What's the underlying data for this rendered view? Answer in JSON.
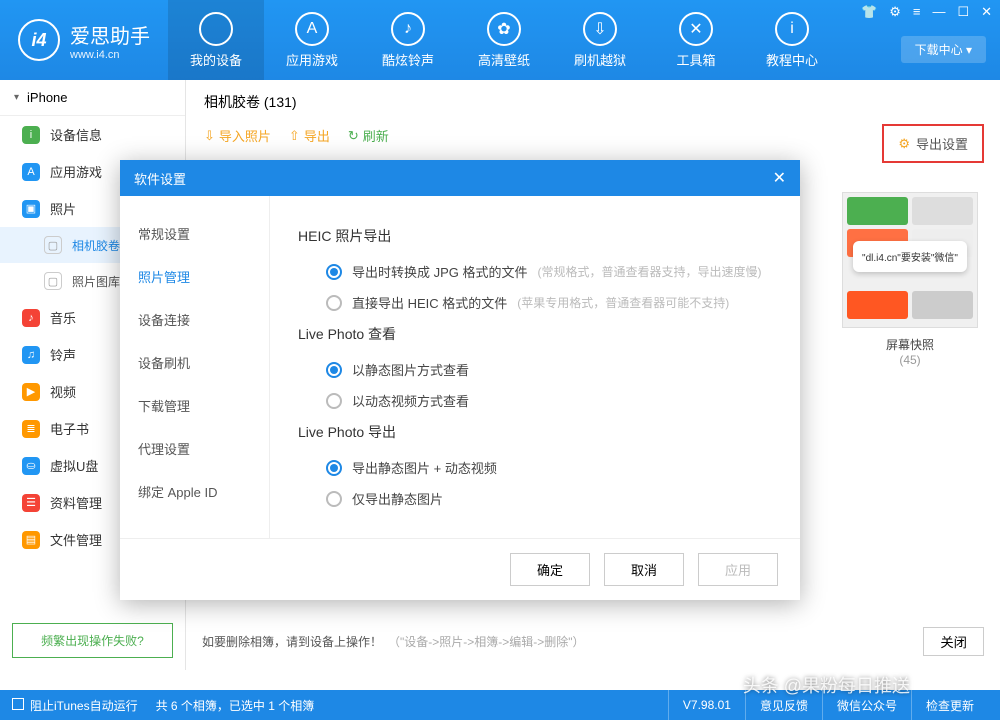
{
  "app": {
    "name": "爱思助手",
    "site": "www.i4.cn",
    "logo": "i4"
  },
  "titlebar": {
    "download": "下载中心 ▾"
  },
  "nav": [
    {
      "label": "我的设备",
      "icon": ""
    },
    {
      "label": "应用游戏",
      "icon": "A"
    },
    {
      "label": "酷炫铃声",
      "icon": "♪"
    },
    {
      "label": "高清壁纸",
      "icon": "✿"
    },
    {
      "label": "刷机越狱",
      "icon": "⇩"
    },
    {
      "label": "工具箱",
      "icon": "✕"
    },
    {
      "label": "教程中心",
      "icon": "i"
    }
  ],
  "device": "iPhone",
  "sidebar": [
    {
      "label": "设备信息",
      "color": "#4caf50",
      "glyph": "i"
    },
    {
      "label": "应用游戏",
      "color": "#2196f3",
      "glyph": "A"
    },
    {
      "label": "照片",
      "color": "#2196f3",
      "glyph": "▣"
    },
    {
      "label": "相机胶卷",
      "sub": true,
      "active": true
    },
    {
      "label": "照片图库",
      "sub": true
    },
    {
      "label": "音乐",
      "color": "#f44336",
      "glyph": "♪"
    },
    {
      "label": "铃声",
      "color": "#2196f3",
      "glyph": "♫"
    },
    {
      "label": "视频",
      "color": "#ff9800",
      "glyph": "▶"
    },
    {
      "label": "电子书",
      "color": "#ff9800",
      "glyph": "≣"
    },
    {
      "label": "虚拟U盘",
      "color": "#2196f3",
      "glyph": "⛀"
    },
    {
      "label": "资料管理",
      "color": "#f44336",
      "glyph": "☰"
    },
    {
      "label": "文件管理",
      "color": "#ff9800",
      "glyph": "▤"
    }
  ],
  "help": "频繁出现操作失败?",
  "main": {
    "title": "相机胶卷 (131)",
    "toolbar": {
      "import": "导入照片",
      "export": "导出",
      "refresh": "刷新"
    },
    "exportSettings": "导出设置",
    "album": {
      "name": "屏幕快照",
      "count": "(45)",
      "bubble": "\"dl.i4.cn\"要安装\"微信\""
    },
    "deleteTip": "如要删除相簿，请到设备上操作！",
    "deleteHint": "（\"设备->照片->相簿->编辑->删除\"）",
    "close": "关闭"
  },
  "modal": {
    "title": "软件设置",
    "side": [
      "常规设置",
      "照片管理",
      "设备连接",
      "设备刷机",
      "下载管理",
      "代理设置",
      "绑定 Apple ID"
    ],
    "sideActive": 1,
    "sections": {
      "heic": {
        "title": "HEIC 照片导出",
        "opts": [
          {
            "label": "导出时转换成 JPG 格式的文件",
            "hint": "(常规格式，普通查看器支持，导出速度慢)",
            "checked": true
          },
          {
            "label": "直接导出 HEIC 格式的文件",
            "hint": "(苹果专用格式，普通查看器可能不支持)",
            "checked": false
          }
        ]
      },
      "liveView": {
        "title": "Live Photo 查看",
        "opts": [
          {
            "label": "以静态图片方式查看",
            "checked": true
          },
          {
            "label": "以动态视频方式查看",
            "checked": false
          }
        ]
      },
      "liveExport": {
        "title": "Live Photo 导出",
        "opts": [
          {
            "label": "导出静态图片 + 动态视频",
            "checked": true
          },
          {
            "label": "仅导出静态图片",
            "checked": false
          }
        ]
      }
    },
    "buttons": {
      "ok": "确定",
      "cancel": "取消",
      "apply": "应用"
    }
  },
  "status": {
    "block": "阻止iTunes自动运行",
    "summary": "共 6 个相簿，已选中 1 个相簿",
    "version": "V7.98.01",
    "btns": [
      "意见反馈",
      "微信公众号",
      "检查更新"
    ]
  },
  "watermark": "头条 @果粉每日推送"
}
